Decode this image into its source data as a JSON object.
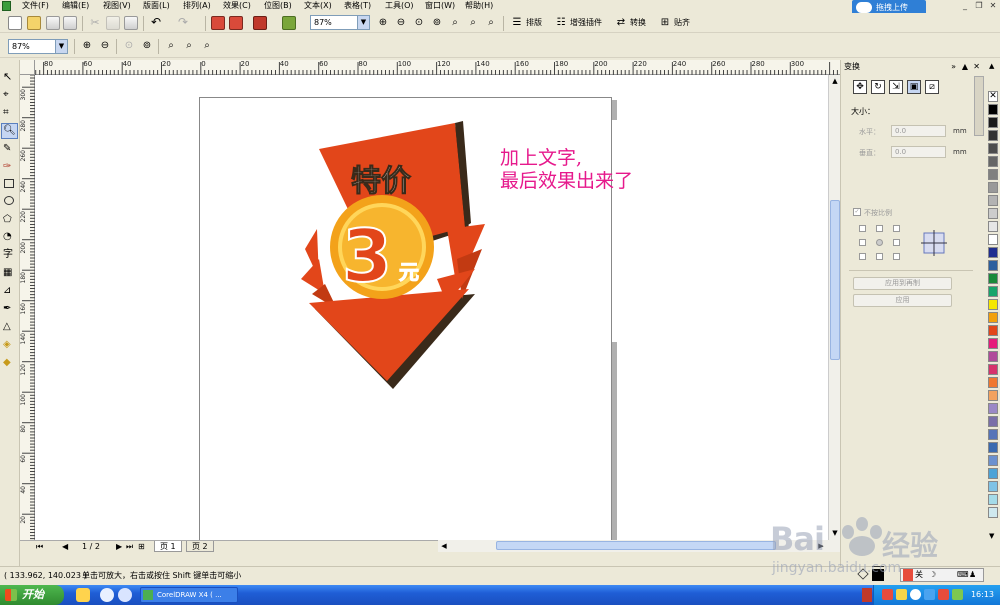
{
  "menubar": {
    "items": [
      "文件(F)",
      "编辑(E)",
      "视图(V)",
      "版面(L)",
      "排列(A)",
      "效果(C)",
      "位图(B)",
      "文本(X)",
      "表格(T)",
      "工具(O)",
      "窗口(W)",
      "帮助(H)"
    ],
    "upload_label": "拖拽上传"
  },
  "toolbar1": {
    "zoom_value": "87%",
    "plugin_labels": [
      "排版",
      "增强插件",
      "转换",
      "贴齐"
    ]
  },
  "toolbar2": {
    "zoom_value": "87%"
  },
  "ruler": {
    "h_labels": [
      "80",
      "60",
      "40",
      "20",
      "0",
      "20",
      "40",
      "60",
      "80",
      "100",
      "120",
      "140",
      "160",
      "180",
      "200",
      "220",
      "240",
      "260",
      "280",
      "300"
    ],
    "v_labels": [
      "300",
      "280",
      "260",
      "240",
      "220",
      "200",
      "180",
      "160",
      "140",
      "120",
      "100",
      "80",
      "60",
      "40",
      "20"
    ]
  },
  "artwork": {
    "title_text": "特价",
    "price_number": "3",
    "price_unit": "元",
    "colors": {
      "orange": "#e2461a",
      "dark_orange": "#c23a12",
      "shadow": "#3a2a1a",
      "coin": "#f7a823",
      "coin_light": "#ffd65a"
    }
  },
  "caption": {
    "line1": "加上文字,",
    "line2": "最后效果出来了",
    "color": "#e6198c"
  },
  "pagebar": {
    "page_counter": "1 / 2",
    "tabs": [
      "页 1",
      "页 2"
    ]
  },
  "statusbar": {
    "coords": "( 133.962, 140.023 )",
    "hint": "单击可放大，右击或按住 Shift 键单击可缩小"
  },
  "docker": {
    "title": "变换",
    "size_label": "大小：",
    "h_label": "水平：",
    "v_label": "垂直：",
    "h_value": "0.0",
    "v_value": "0.0",
    "unit": "mm",
    "proportional_label": "不按比例",
    "apply_copy_label": "应用到再制",
    "apply_label": "应用"
  },
  "palette": {
    "colors": [
      "#000000",
      "#1a1a1a",
      "#333333",
      "#4d4d4d",
      "#666666",
      "#808080",
      "#999999",
      "#b3b3b3",
      "#cccccc",
      "#e6e6e6",
      "#ffffff",
      "#1f2d8f",
      "#2c5f9e",
      "#1a8a3a",
      "#17a56a",
      "#f5e800",
      "#f2a00c",
      "#e2461a",
      "#e61c7a",
      "#b04a9a",
      "#d6336c",
      "#f07830",
      "#f3a25f",
      "#9a88c6",
      "#7a6fa8",
      "#5674b8",
      "#3a6ab0",
      "#6b91cf",
      "#4da3d6",
      "#7fc3e6",
      "#a4dbe8",
      "#cfe9ef"
    ]
  },
  "taskbar": {
    "start_label": "开始",
    "task_label": "CorelDRAW X4 ( ...",
    "tray_text": "关",
    "clock": "16:13"
  },
  "watermark": {
    "brand": "Bai",
    "brand2": "经验",
    "url": "jingyan.baidu.com"
  }
}
